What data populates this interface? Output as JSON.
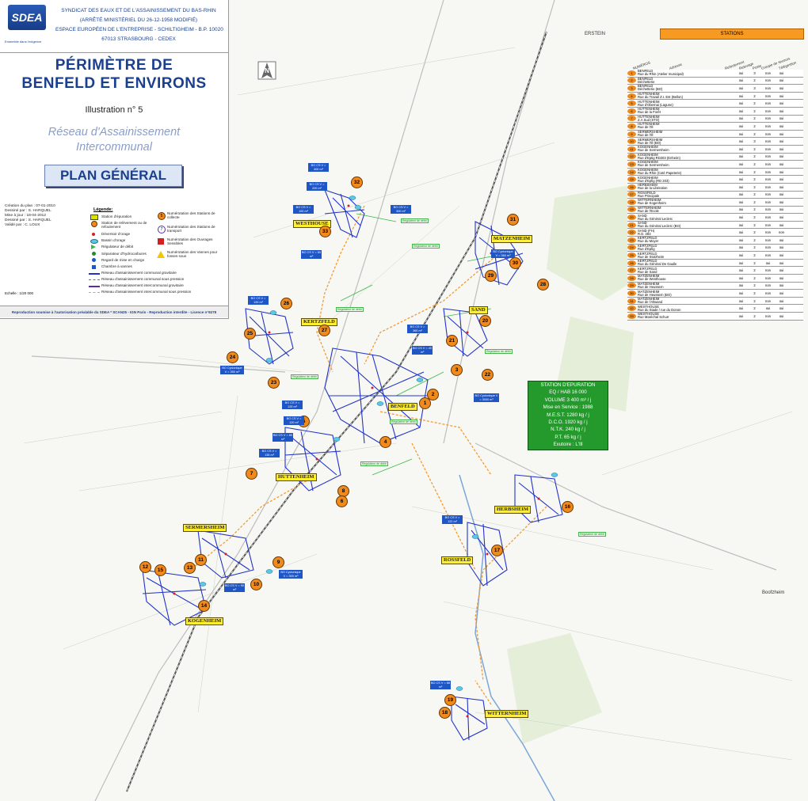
{
  "header": {
    "logo_text": "SDEA",
    "logo_sub": "Ensemble dans l'exigence",
    "org_lines": [
      "SYNDICAT DES EAUX ET DE L'ASSAINISSEMENT DU BAS-RHIN",
      "(ARRÊTÉ MINISTÉRIEL DU 26-12-1958 MODIFIÉ)",
      "ESPACE EUROPÉEN DE L'ENTREPRISE - SCHILTIGHEIM - B.P. 10020",
      "67013 STRASBOURG - CEDEX"
    ],
    "title_line1": "PÉRIMÈTRE DE",
    "title_line2": "BENFELD ET ENVIRONS",
    "illustration": "Illustration n° 5",
    "reseau_line1": "Réseau d'Assainissement",
    "reseau_line2": "Intercommunal",
    "plan": "PLAN GÉNÉRAL"
  },
  "meta": {
    "lines": [
      "Création du plan : 07-01-2010",
      "Dessiné par : S. HARQUEL",
      "Mise à jour : 18-04-2012",
      "Dessiné par : S. HARQUEL",
      "Validé par : C. LOUX"
    ],
    "echelle": "Echelle : 1/20 000"
  },
  "legend": {
    "title": "Légende:",
    "items": [
      "Station d'épuration",
      "Station de relèvement ou de refoulement",
      "Déversoir d'orage",
      "Bassin d'orage",
      "Régulateur de débit",
      "Séparateur d'hydrocarbures",
      "Regard de mise en charge",
      "Chambre à vannes",
      "Réseau d'assainissement communal gravitaire",
      "Réseau d'assainissement communal sous pression",
      "Réseau d'assainissement intercommunal gravitaire",
      "Réseau d'assainissement intercommunal sous pression"
    ],
    "items_right": [
      "Numérotation des Stations de collecte",
      "Numérotation des Stations de transport",
      "Numérotation des Ouvrages Sensibles",
      "Numérotation des Vannes pour fosses sous"
    ],
    "symbol_num_station": "5",
    "symbol_num_transport": "7"
  },
  "repro": "Reproduction soumise à l'autorisation préalable du SDEA  *  SCAN25 - IGN Paris - Reproduction interdite - Licence n°9278",
  "stations": {
    "header": "STATIONS",
    "columns": [
      "NUMÉROS",
      "Adresse",
      "Refoulement",
      "Relevage",
      "Poste",
      "Groupe de secours",
      "Télégestion"
    ],
    "rows": [
      {
        "n": "1",
        "name": "BENFELD",
        "addr": "Rue du Rhin (Atelier municipal)",
        "a": "oui",
        "b": "3",
        "c": "non",
        "d": "oui"
      },
      {
        "n": "2",
        "name": "BENFELD",
        "addr": "Déchetterie",
        "a": "oui",
        "b": "2",
        "c": "non",
        "d": "oui"
      },
      {
        "n": "3",
        "name": "BENFELD",
        "addr": "Déchetterie (BO)",
        "a": "oui",
        "b": "3",
        "c": "non",
        "d": "oui"
      },
      {
        "n": "4",
        "name": "HUTTENHEIM",
        "addr": "Rue du Travail Z.I. Est (Bellon)",
        "a": "oui",
        "b": "2",
        "c": "non",
        "d": "oui"
      },
      {
        "n": "5",
        "name": "HUTTENHEIM",
        "addr": "Rue d'Obernai (Lagune)",
        "a": "oui",
        "b": "2",
        "c": "non",
        "d": "oui"
      },
      {
        "n": "6",
        "name": "HUTTENHEIM",
        "addr": "Rue de la Forêt",
        "a": "oui",
        "b": "2",
        "c": "non",
        "d": "oui"
      },
      {
        "n": "7",
        "name": "HUTTENHEIM",
        "addr": "Z.A Sud (STO)",
        "a": "oui",
        "b": "2",
        "c": "non",
        "d": "oui"
      },
      {
        "n": "8",
        "name": "HUTTENHEIM",
        "addr": "Rue de l'Ill",
        "a": "oui",
        "b": "2",
        "c": "non",
        "d": "oui"
      },
      {
        "n": "9",
        "name": "SERMERSHEIM",
        "addr": "Rue de l'Ill",
        "a": "oui",
        "b": "2",
        "c": "non",
        "d": "oui"
      },
      {
        "n": "10",
        "name": "SERMERSHEIM",
        "addr": "Rue de l'Ill (BO)",
        "a": "oui",
        "b": "3",
        "c": "non",
        "d": "oui"
      },
      {
        "n": "11",
        "name": "KOGENHEIM",
        "addr": "Rue de Sermersheim",
        "a": "oui",
        "b": "2",
        "c": "non",
        "d": "oui"
      },
      {
        "n": "12",
        "name": "KOGENHEIM",
        "addr": "Rue d'Eptig RD203 (Enheim)",
        "a": "oui",
        "b": "2",
        "c": "non",
        "d": "oui"
      },
      {
        "n": "13",
        "name": "KOGENHEIM",
        "addr": "Rue de Sermersheim",
        "a": "oui",
        "b": "2",
        "c": "non",
        "d": "oui"
      },
      {
        "n": "14",
        "name": "KOGENHEIM",
        "addr": "Rue du Rhin (Coté Papeterie)",
        "a": "oui",
        "b": "2",
        "c": "non",
        "d": "oui"
      },
      {
        "n": "15",
        "name": "KOGENHEIM",
        "addr": "Rue d'Epfig (RD 203)",
        "a": "oui",
        "b": "2",
        "c": "non",
        "d": "oui"
      },
      {
        "n": "16",
        "name": "HERBSHEIM",
        "addr": "Rue de la Libération",
        "a": "oui",
        "b": "2",
        "c": "non",
        "d": "oui"
      },
      {
        "n": "17",
        "name": "ROSSFELD",
        "addr": "Rue Principale",
        "a": "oui",
        "b": "2",
        "c": "non",
        "d": "oui"
      },
      {
        "n": "18",
        "name": "WITTERNHEIM",
        "addr": "Rue de Kogenheim",
        "a": "oui",
        "b": "2",
        "c": "non",
        "d": "oui"
      },
      {
        "n": "19",
        "name": "WITTERNHEIM",
        "addr": "Rue de l'Ecole",
        "a": "oui",
        "b": "2",
        "c": "non",
        "d": "oui"
      },
      {
        "n": "20",
        "name": "SAND",
        "addr": "Rue du Général Leclerc",
        "a": "oui",
        "b": "2",
        "c": "non",
        "d": "oui"
      },
      {
        "n": "21",
        "name": "SAND",
        "addr": "Rue du Général Leclerc (BO)",
        "a": "oui",
        "b": "2",
        "c": "non",
        "d": "oui"
      },
      {
        "n": "22",
        "name": "SAND (FH)",
        "addr": "R.D. 283",
        "a": "oui",
        "b": "2",
        "c": "non",
        "d": "non"
      },
      {
        "n": "23",
        "name": "KERTZFELD",
        "addr": "Rue du Moyer",
        "a": "oui",
        "b": "2",
        "c": "non",
        "d": "oui"
      },
      {
        "n": "24",
        "name": "KERTZFELD",
        "addr": "Rue d'Epfig",
        "a": "oui",
        "b": "2",
        "c": "non",
        "d": "oui"
      },
      {
        "n": "25",
        "name": "KERTZFELD",
        "addr": "Rue de Stotzheim",
        "a": "oui",
        "b": "2",
        "c": "non",
        "d": "oui"
      },
      {
        "n": "26",
        "name": "KERTZFELD",
        "addr": "Rue du Général De Gaulle",
        "a": "oui",
        "b": "2",
        "c": "oui",
        "d": "oui"
      },
      {
        "n": "27",
        "name": "KERTZFELD",
        "addr": "Rue de Sand",
        "a": "oui",
        "b": "2",
        "c": "non",
        "d": "oui"
      },
      {
        "n": "28",
        "name": "MATZENHEIM",
        "addr": "Rue de Westhouse",
        "a": "oui",
        "b": "2",
        "c": "non",
        "d": "oui"
      },
      {
        "n": "29",
        "name": "MATZENHEIM",
        "addr": "Rue de Heussern",
        "a": "oui",
        "b": "2",
        "c": "non",
        "d": "oui"
      },
      {
        "n": "30",
        "name": "MATZENHEIM",
        "addr": "Rue de Heussern (BO)",
        "a": "oui",
        "b": "2",
        "c": "non",
        "d": "oui"
      },
      {
        "n": "31",
        "name": "MATZENHEIM",
        "addr": "Rue de l'Altwand",
        "a": "oui",
        "b": "2",
        "c": "non",
        "d": "oui"
      },
      {
        "n": "32",
        "name": "WESTHOUSE",
        "addr": "Rue du Stade / rue du Donon",
        "a": "oui",
        "b": "2",
        "c": "oui",
        "d": "oui"
      },
      {
        "n": "33",
        "name": "WESTHOUSE",
        "addr": "Rue Maréchal Schurr",
        "a": "oui",
        "b": "2",
        "c": "non",
        "d": "oui"
      }
    ]
  },
  "step": {
    "lines": [
      "STATION D'EPURATION",
      "EQ / HAB 16 000",
      "VOLUME 3 400 m³ / j",
      "Mise en Service : 1988",
      "M.E.S.T. 1280 kg / j",
      "D.C.O. 1920 kg / j",
      "N.T.K. 240 kg / j",
      "P.T. 65 kg / j",
      "Exutoire : L'Ill"
    ]
  },
  "communes": [
    "WESTHOUSE",
    "MATZENHEIM",
    "SAND",
    "KERTZFELD",
    "BENFELD",
    "HUTTENHEIM",
    "HERBSHEIM",
    "SERMERSHEIM",
    "ROSSFELD",
    "KOGENHEIM",
    "WITTERNHEIM"
  ],
  "map_labels": [
    "ERSTEIN",
    "Boofzheim"
  ],
  "markers": [
    "32",
    "33",
    "31",
    "30",
    "29",
    "28",
    "26",
    "27",
    "25",
    "20",
    "21",
    "24",
    "23",
    "3",
    "22",
    "2",
    "1",
    "5",
    "4",
    "7",
    "8",
    "6",
    "16",
    "17",
    "9",
    "11",
    "12",
    "15",
    "13",
    "10",
    "14",
    "19",
    "18"
  ],
  "bo_labels": [
    "BO CS V = 400 m³",
    "BO CS V = 200 m³",
    "BO CS V = 100 m³",
    "BO CS V = 300 m³",
    "BO CS V = 60 m³",
    "BO Cyclonique V = 360 m³",
    "BO CS V = 120 m³",
    "BO CS V = 360 m³",
    "BO CS V = 40 m³",
    "BO Cyclonique V = 350 m³",
    "BO Cyclonique V = 3000 m³",
    "BO CS V = 125 m³",
    "BO CS V = 120 m³",
    "BO CS V = 80 m³",
    "BO CS V = 135 m³",
    "BO CS V = 122 m³",
    "BO Cyclonique V = 300 m³",
    "BO CS V = 90 m³",
    "BO CS V = 68 m³"
  ],
  "regulators": [
    "Régulateur de débit",
    "Régulateur de débit",
    "Régulateur de débit",
    "Régulateur de débit",
    "Régulateur de débit",
    "Régulateur de débit",
    "Régulateur de débit",
    "Régulateur de débit"
  ],
  "colors": {
    "accent_blue": "#1a3f8f",
    "station_orange": "#f08a1c",
    "commune_yellow": "#ffef2e",
    "step_green": "#249a2c",
    "network_blue": "#2333c8",
    "pressure_orange": "#f7a54a"
  }
}
